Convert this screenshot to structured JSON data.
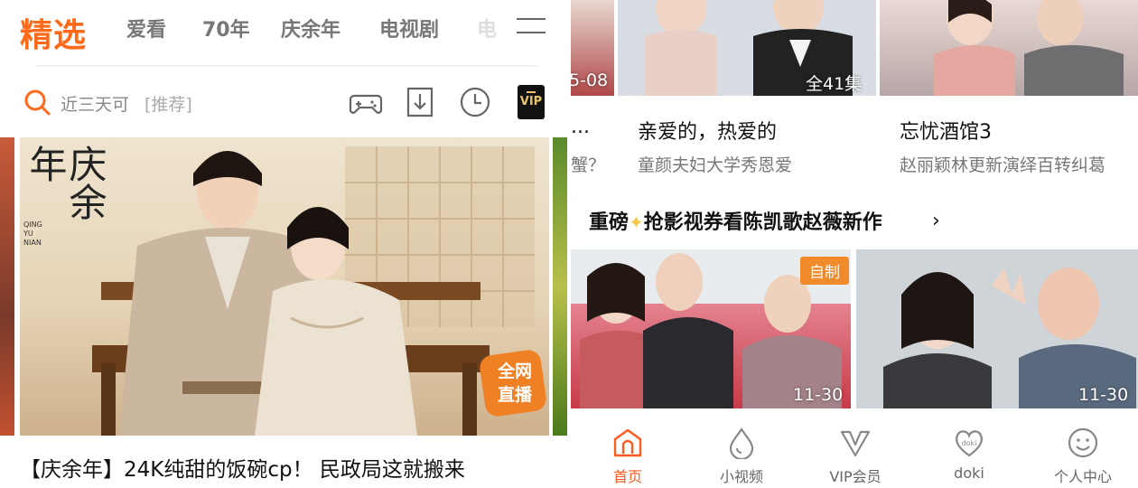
{
  "left": {
    "brand": "精选",
    "tabs": [
      "爱看",
      "70年",
      "庆余年",
      "电视剧",
      "电"
    ],
    "search": {
      "text": "近三天可",
      "hint": "[推荐]"
    },
    "vip_icon_text": "VIP",
    "hero": {
      "logo_text": "庆余年",
      "logo_sub": "QING YU NIAN",
      "live_badge_line1": "全网",
      "live_badge_line2": "直播",
      "title": "【庆余年】24K纯甜的饭碗cp！ 民政局这就搬来"
    },
    "icons": [
      "search-icon",
      "gamepad-icon",
      "download-icon",
      "history-clock-icon",
      "vip-icon",
      "menu-icon"
    ]
  },
  "right": {
    "top_thumbs": [
      {
        "caption": "5-08"
      },
      {
        "caption": "全41集"
      },
      {
        "caption": ""
      }
    ],
    "cards": [
      {
        "title": "...",
        "subtitle": "蟹？"
      },
      {
        "title": "亲爱的，热爱的",
        "subtitle": "童颜夫妇大学秀恩爱"
      },
      {
        "title": "忘忧酒馆3",
        "subtitle": "赵丽颖林更新演绎百转纠葛"
      }
    ],
    "promo": {
      "text_before": "重磅",
      "text_after": "抢影视券看陈凯歌赵薇新作",
      "arrow": "›"
    },
    "videos": [
      {
        "badge": "自制",
        "duration": "11-30"
      },
      {
        "badge": "",
        "duration": "11-30"
      }
    ],
    "tabbar": [
      {
        "label": "首页",
        "icon": "home-icon",
        "active": true
      },
      {
        "label": "小视频",
        "icon": "droplet-icon",
        "active": false
      },
      {
        "label": "VIP会员",
        "icon": "vip-crown-icon",
        "active": false
      },
      {
        "label": "doki",
        "icon": "doki-heart-icon",
        "active": false
      },
      {
        "label": "个人中心",
        "icon": "smiley-icon",
        "active": false
      }
    ]
  },
  "colors": {
    "accent": "#ff6a1a",
    "active_tab": "#ff5a1f",
    "badge_orange": "#f08a2a",
    "text_primary": "#111111",
    "text_secondary": "#777777"
  }
}
